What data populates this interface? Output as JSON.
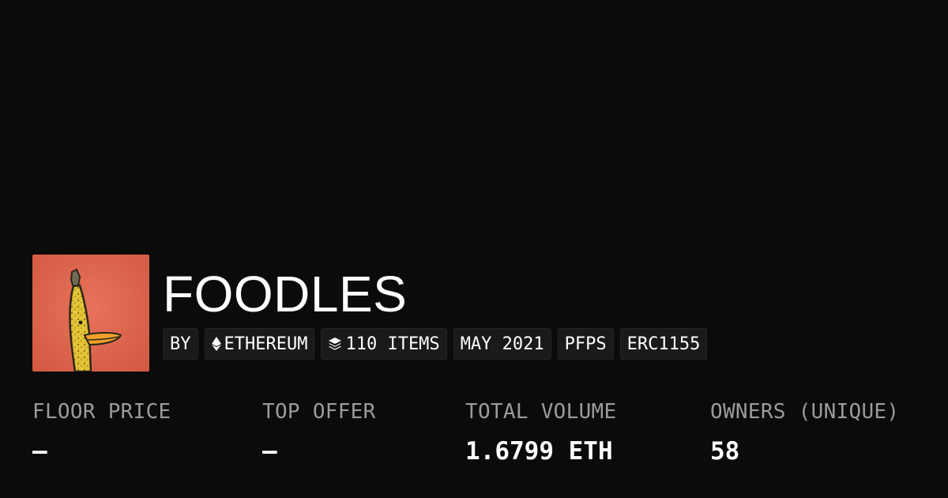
{
  "collection": {
    "title": "FOODLES",
    "avatar_icon": "banana-duck-avatar-image"
  },
  "tags": {
    "by": "BY",
    "chain": "ETHEREUM",
    "chain_icon": "ethereum-icon",
    "items": "110 ITEMS",
    "items_icon": "layers-icon",
    "date": "MAY 2021",
    "category": "PFPS",
    "standard": "ERC1155"
  },
  "stats": {
    "floor_price": {
      "label": "FLOOR PRICE",
      "value": "–"
    },
    "top_offer": {
      "label": "TOP OFFER",
      "value": "–"
    },
    "total_volume": {
      "label": "TOTAL VOLUME",
      "value": "1.6799 ETH"
    },
    "owners": {
      "label": "OWNERS (UNIQUE)",
      "value": "58"
    }
  },
  "colors": {
    "background": "#0b0b0b",
    "tag_background": "#1a1a1a",
    "label_gray": "#9b9b9b",
    "avatar_background": "#e06a4e",
    "banana_yellow": "#e8c93a"
  }
}
